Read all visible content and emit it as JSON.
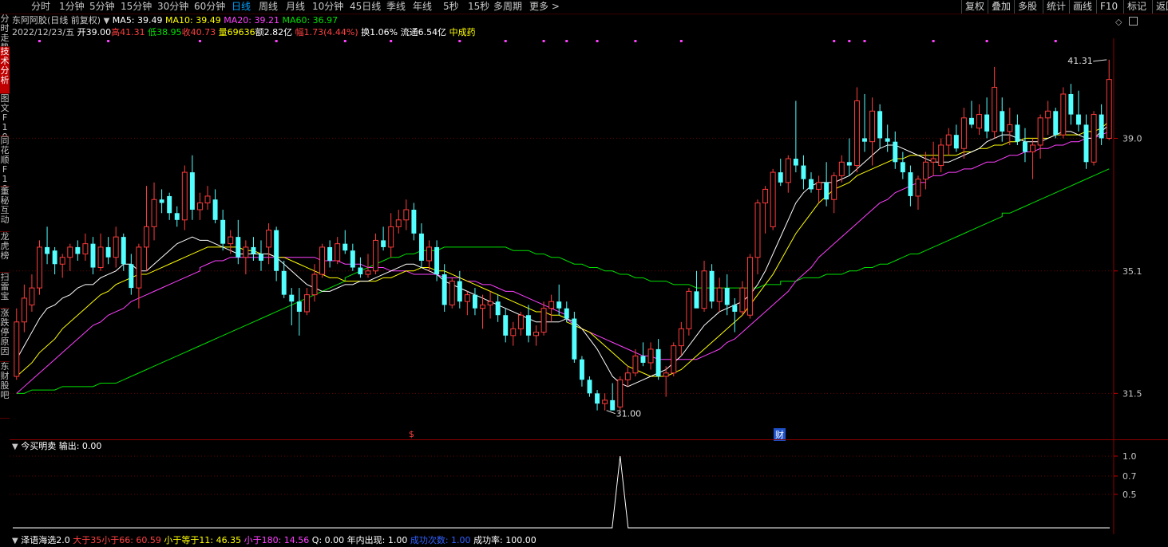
{
  "toolbar": {
    "periods": [
      "分时",
      "1分钟",
      "5分钟",
      "15分钟",
      "30分钟",
      "60分钟",
      "日线",
      "周线",
      "月线",
      "10分钟",
      "45日线",
      "季线",
      "年线",
      "5秒",
      "15秒",
      "多周期",
      "更多 >"
    ],
    "active_period": "日线",
    "right_buttons": [
      "复权",
      "叠加",
      "多股",
      "统计",
      "画线",
      "F10",
      "标记",
      "返回"
    ]
  },
  "sidebar": {
    "tabs": [
      "分时走势",
      "技术分析",
      "图文F10",
      "同花顺F10",
      "董秘互动",
      "龙虎榜",
      "扫雷宝",
      "涨跌停原因",
      "东财股吧"
    ],
    "active": "技术分析"
  },
  "quote": {
    "name": "东阿阿胶(日线 前复权)",
    "ma5": "MA5: 39.49",
    "ma10": "MA10: 39.49",
    "ma20": "MA20: 39.21",
    "ma60": "MA60: 36.97",
    "date": "2022/12/23/五",
    "open": "开39.00",
    "high": "高41.31",
    "low": "低38.95",
    "close": "收40.73",
    "volume": "量69636",
    "amount": "额2.82亿",
    "range": "幅1.73(4.44%)",
    "turnover": "换1.06%",
    "float": "流通6.54亿",
    "sector": "中成药",
    "colors": {
      "up": "#ff3c3c",
      "down": "#54ffff",
      "ma5": "#ffffff",
      "ma10": "#ffff00",
      "ma20": "#ff40ff",
      "ma60": "#00e000"
    }
  },
  "main_chart": {
    "price_ticks": [
      "39.0",
      "35.1",
      "31.5"
    ],
    "high_label": "41.31",
    "low_label": "31.00",
    "event_marks": [
      "$",
      "财"
    ]
  },
  "indicator1": {
    "title": "今买明卖",
    "output": "输出: 0.00",
    "ticks": [
      "1.0",
      "0.7",
      "0.5"
    ]
  },
  "indicator2": {
    "title": "泽语海选2.0",
    "items": [
      "大于35小于66: 60.59",
      "小于等于11: 46.35",
      "小于180: 14.56",
      "Q: 0.00",
      "年内出现: 1.00",
      "成功次数: 1.00",
      "成功率: 100.00"
    ]
  },
  "chart_data": {
    "type": "candlestick",
    "ylim": [
      30.5,
      41.8
    ],
    "candles": [
      [
        32.0,
        34.0,
        31.9,
        33.6
      ],
      [
        33.6,
        34.7,
        33.3,
        34.3
      ],
      [
        34.1,
        35.0,
        33.9,
        34.6
      ],
      [
        34.6,
        36.0,
        34.4,
        35.8
      ],
      [
        35.8,
        36.4,
        35.3,
        35.6
      ],
      [
        35.7,
        35.8,
        35.0,
        35.3
      ],
      [
        35.3,
        35.6,
        34.9,
        35.5
      ],
      [
        35.5,
        35.9,
        35.1,
        35.8
      ],
      [
        35.8,
        36.0,
        35.4,
        35.6
      ],
      [
        35.6,
        36.2,
        35.4,
        35.9
      ],
      [
        35.9,
        36.1,
        35.0,
        35.2
      ],
      [
        35.2,
        36.2,
        35.1,
        35.8
      ],
      [
        35.8,
        36.1,
        35.3,
        35.5
      ],
      [
        35.5,
        36.4,
        35.2,
        36.1
      ],
      [
        36.1,
        36.2,
        35.1,
        35.3
      ],
      [
        35.3,
        35.6,
        34.4,
        34.6
      ],
      [
        34.6,
        35.9,
        34.0,
        35.8
      ],
      [
        35.8,
        37.6,
        35.1,
        36.4
      ],
      [
        36.4,
        37.7,
        36.0,
        37.2
      ],
      [
        37.2,
        37.5,
        36.8,
        37.1
      ],
      [
        37.3,
        37.4,
        36.6,
        36.8
      ],
      [
        36.8,
        37.0,
        36.4,
        36.6
      ],
      [
        36.6,
        38.2,
        36.3,
        38.0
      ],
      [
        38.0,
        38.5,
        36.6,
        36.9
      ],
      [
        36.9,
        37.4,
        36.6,
        37.1
      ],
      [
        37.1,
        37.6,
        36.9,
        37.3
      ],
      [
        37.2,
        37.5,
        36.5,
        36.6
      ],
      [
        36.6,
        36.9,
        35.7,
        35.9
      ],
      [
        35.9,
        36.3,
        35.6,
        36.1
      ],
      [
        36.1,
        36.6,
        35.3,
        35.5
      ],
      [
        35.5,
        36.0,
        35.0,
        35.8
      ],
      [
        35.8,
        36.1,
        35.4,
        35.6
      ],
      [
        35.6,
        36.0,
        35.1,
        35.4
      ],
      [
        35.8,
        36.5,
        35.3,
        36.3
      ],
      [
        36.3,
        36.4,
        34.8,
        35.1
      ],
      [
        35.1,
        35.4,
        34.3,
        34.4
      ],
      [
        34.4,
        34.6,
        33.5,
        34.2
      ],
      [
        34.2,
        34.6,
        33.2,
        33.9
      ],
      [
        33.9,
        34.6,
        33.8,
        34.4
      ],
      [
        34.4,
        35.3,
        34.2,
        35.0
      ],
      [
        35.0,
        35.9,
        34.9,
        35.8
      ],
      [
        35.8,
        36.0,
        35.2,
        35.4
      ],
      [
        35.4,
        36.1,
        35.3,
        35.9
      ],
      [
        35.9,
        36.3,
        35.6,
        35.7
      ],
      [
        35.7,
        35.9,
        35.1,
        35.2
      ],
      [
        35.2,
        35.5,
        34.9,
        35.0
      ],
      [
        35.0,
        35.6,
        34.9,
        35.1
      ],
      [
        35.1,
        36.2,
        35.0,
        36.0
      ],
      [
        36.0,
        36.4,
        35.7,
        35.8
      ],
      [
        35.8,
        36.8,
        35.5,
        36.4
      ],
      [
        36.4,
        36.9,
        36.2,
        36.6
      ],
      [
        36.6,
        37.2,
        36.3,
        36.9
      ],
      [
        36.9,
        37.1,
        36.0,
        36.2
      ],
      [
        36.2,
        36.5,
        35.2,
        35.4
      ],
      [
        35.4,
        36.0,
        35.1,
        35.8
      ],
      [
        35.8,
        36.0,
        34.8,
        35.0
      ],
      [
        35.0,
        35.3,
        33.9,
        34.1
      ],
      [
        34.1,
        34.9,
        34.0,
        34.8
      ],
      [
        34.8,
        35.1,
        34.0,
        34.2
      ],
      [
        34.2,
        34.5,
        33.8,
        34.4
      ],
      [
        34.4,
        34.6,
        33.8,
        34.0
      ],
      [
        34.0,
        34.4,
        33.4,
        34.1
      ],
      [
        34.1,
        34.5,
        33.7,
        34.2
      ],
      [
        34.2,
        34.4,
        33.6,
        33.8
      ],
      [
        33.8,
        34.0,
        33.0,
        33.2
      ],
      [
        33.2,
        33.6,
        32.9,
        33.4
      ],
      [
        33.4,
        33.9,
        33.2,
        33.8
      ],
      [
        33.8,
        34.1,
        33.0,
        33.2
      ],
      [
        33.2,
        33.5,
        32.9,
        33.3
      ],
      [
        33.3,
        34.2,
        33.2,
        34.0
      ],
      [
        34.0,
        34.4,
        33.6,
        34.2
      ],
      [
        34.2,
        34.7,
        33.8,
        34.0
      ],
      [
        34.0,
        34.2,
        33.6,
        33.7
      ],
      [
        33.7,
        33.9,
        32.4,
        32.5
      ],
      [
        32.5,
        32.6,
        31.7,
        31.9
      ],
      [
        31.9,
        32.0,
        31.4,
        31.5
      ],
      [
        31.5,
        31.6,
        31.0,
        31.2
      ],
      [
        31.2,
        31.5,
        31.0,
        31.3
      ],
      [
        31.3,
        31.8,
        31.1,
        31.0
      ],
      [
        31.1,
        32.0,
        31.0,
        31.9
      ],
      [
        31.9,
        32.3,
        31.7,
        32.1
      ],
      [
        32.1,
        32.8,
        32.0,
        32.6
      ],
      [
        32.6,
        33.0,
        32.3,
        32.4
      ],
      [
        32.4,
        33.0,
        32.2,
        32.8
      ],
      [
        32.8,
        33.1,
        31.9,
        32.0
      ],
      [
        32.0,
        32.3,
        31.4,
        32.1
      ],
      [
        32.1,
        33.0,
        32.0,
        32.9
      ],
      [
        32.9,
        33.6,
        32.6,
        33.4
      ],
      [
        33.4,
        34.6,
        33.2,
        34.5
      ],
      [
        34.5,
        35.1,
        34.1,
        34.0
      ],
      [
        34.0,
        35.4,
        33.9,
        35.1
      ],
      [
        35.1,
        35.3,
        34.0,
        34.2
      ],
      [
        34.2,
        34.9,
        33.9,
        34.6
      ],
      [
        34.6,
        35.0,
        33.8,
        34.1
      ],
      [
        34.1,
        34.3,
        33.3,
        33.9
      ],
      [
        33.9,
        34.8,
        33.8,
        34.6
      ],
      [
        33.8,
        35.6,
        33.7,
        35.5
      ],
      [
        35.5,
        37.2,
        35.0,
        37.1
      ],
      [
        37.1,
        37.6,
        36.2,
        37.5
      ],
      [
        36.4,
        38.1,
        36.3,
        38.0
      ],
      [
        38.0,
        38.4,
        37.6,
        37.7
      ],
      [
        37.7,
        38.5,
        37.4,
        38.4
      ],
      [
        38.4,
        40.1,
        38.0,
        38.2
      ],
      [
        38.2,
        38.5,
        37.5,
        37.8
      ],
      [
        37.8,
        38.0,
        37.4,
        37.5
      ],
      [
        37.5,
        37.9,
        37.1,
        37.7
      ],
      [
        37.7,
        38.3,
        37.0,
        37.2
      ],
      [
        37.2,
        38.0,
        36.8,
        37.9
      ],
      [
        37.9,
        38.5,
        37.7,
        38.3
      ],
      [
        38.3,
        39.0,
        37.9,
        38.2
      ],
      [
        38.2,
        40.5,
        38.0,
        40.1
      ],
      [
        39.0,
        40.3,
        38.6,
        38.9
      ],
      [
        38.9,
        40.2,
        38.2,
        39.8
      ],
      [
        39.8,
        40.0,
        38.7,
        39.0
      ],
      [
        39.0,
        39.4,
        38.6,
        38.9
      ],
      [
        38.9,
        39.2,
        38.1,
        38.3
      ],
      [
        38.3,
        38.6,
        37.8,
        38.0
      ],
      [
        38.0,
        38.2,
        37.0,
        37.3
      ],
      [
        37.3,
        37.9,
        36.9,
        37.8
      ],
      [
        37.8,
        38.6,
        37.5,
        38.3
      ],
      [
        38.3,
        38.9,
        37.9,
        38.4
      ],
      [
        38.2,
        39.0,
        38.0,
        38.8
      ],
      [
        38.8,
        39.3,
        38.5,
        39.1
      ],
      [
        39.1,
        39.4,
        38.6,
        38.7
      ],
      [
        38.7,
        39.9,
        38.4,
        39.6
      ],
      [
        39.6,
        40.1,
        39.3,
        39.4
      ],
      [
        39.3,
        40.0,
        39.1,
        39.7
      ],
      [
        39.7,
        40.2,
        39.0,
        39.2
      ],
      [
        39.2,
        41.1,
        39.0,
        40.5
      ],
      [
        39.8,
        40.2,
        38.9,
        39.2
      ],
      [
        39.2,
        39.9,
        38.8,
        39.4
      ],
      [
        39.4,
        39.7,
        38.8,
        38.9
      ],
      [
        38.9,
        39.3,
        38.3,
        38.6
      ],
      [
        38.6,
        39.0,
        37.8,
        38.8
      ],
      [
        38.8,
        39.7,
        38.4,
        39.6
      ],
      [
        39.6,
        40.1,
        39.1,
        39.8
      ],
      [
        39.8,
        39.9,
        39.0,
        39.1
      ],
      [
        39.1,
        40.5,
        39.0,
        40.3
      ],
      [
        40.3,
        40.6,
        39.4,
        39.7
      ],
      [
        39.7,
        40.4,
        39.2,
        39.4
      ],
      [
        39.4,
        39.7,
        38.1,
        38.3
      ],
      [
        38.3,
        39.8,
        38.2,
        39.7
      ],
      [
        39.7,
        40.0,
        38.8,
        39.0
      ],
      [
        39.0,
        41.31,
        38.95,
        40.73
      ]
    ],
    "ma5": [
      32.5,
      32.9,
      33.3,
      33.7,
      34.0,
      34.1,
      34.3,
      34.4,
      34.6,
      34.7,
      34.7,
      34.9,
      35.0,
      35.1,
      35.3,
      35.3,
      35.1,
      35.1,
      35.3,
      35.5,
      35.7,
      35.9,
      36.0,
      36.1,
      36.0,
      36.0,
      35.9,
      35.8,
      35.7,
      35.6,
      35.6,
      35.6,
      35.6,
      35.6,
      35.5,
      35.3,
      35.1,
      34.9,
      34.7,
      34.6,
      34.5,
      34.5,
      34.6,
      34.7,
      34.7,
      34.8,
      34.8,
      34.9,
      35.0,
      35.1,
      35.2,
      35.3,
      35.3,
      35.2,
      35.1,
      35.0,
      34.8,
      34.7,
      34.6,
      34.5,
      34.4,
      34.3,
      34.2,
      34.1,
      34.0,
      33.9,
      33.8,
      33.7,
      33.6,
      33.6,
      33.6,
      33.6,
      33.7,
      33.7,
      33.6,
      33.4,
      33.1,
      32.8,
      32.4,
      32.0,
      31.8,
      31.7,
      31.8,
      31.9,
      32.0,
      32.1,
      32.2,
      32.4,
      32.6,
      32.9,
      33.2,
      33.5,
      33.7,
      33.9,
      34.0,
      34.1,
      34.2,
      34.4,
      34.7,
      35.1,
      35.6,
      36.1,
      36.6,
      37.1,
      37.4,
      37.6,
      37.7,
      37.7,
      37.7,
      37.8,
      37.9,
      38.1,
      38.3,
      38.5,
      38.7,
      38.8,
      38.8,
      38.7,
      38.6,
      38.5,
      38.4,
      38.3,
      38.3,
      38.3,
      38.4,
      38.5,
      38.6,
      38.7,
      38.9,
      39.0,
      39.1,
      39.1,
      39.0,
      38.9,
      38.9,
      38.9,
      39.0,
      39.1,
      39.2,
      39.2,
      39.1,
      39.0,
      39.0,
      39.2,
      39.4
    ],
    "ma10": [
      32.0,
      32.2,
      32.4,
      32.7,
      32.9,
      33.1,
      33.4,
      33.6,
      33.8,
      34.0,
      34.2,
      34.4,
      34.5,
      34.7,
      34.8,
      34.9,
      35.0,
      35.0,
      35.1,
      35.2,
      35.3,
      35.4,
      35.5,
      35.6,
      35.7,
      35.8,
      35.8,
      35.8,
      35.8,
      35.8,
      35.7,
      35.7,
      35.6,
      35.6,
      35.5,
      35.5,
      35.4,
      35.3,
      35.2,
      35.1,
      35.0,
      34.9,
      34.9,
      34.8,
      34.8,
      34.8,
      34.8,
      34.8,
      34.9,
      34.9,
      35.0,
      35.1,
      35.1,
      35.2,
      35.2,
      35.1,
      35.1,
      35.0,
      34.9,
      34.8,
      34.7,
      34.6,
      34.5,
      34.4,
      34.3,
      34.2,
      34.1,
      34.0,
      33.9,
      33.9,
      33.8,
      33.8,
      33.7,
      33.6,
      33.5,
      33.4,
      33.3,
      33.1,
      32.9,
      32.7,
      32.5,
      32.3,
      32.2,
      32.1,
      32.0,
      32.0,
      32.0,
      32.1,
      32.2,
      32.4,
      32.6,
      32.8,
      33.0,
      33.2,
      33.4,
      33.6,
      33.8,
      34.1,
      34.4,
      34.7,
      35.0,
      35.4,
      35.8,
      36.2,
      36.5,
      36.8,
      37.1,
      37.3,
      37.5,
      37.6,
      37.7,
      37.9,
      38.0,
      38.1,
      38.2,
      38.3,
      38.4,
      38.4,
      38.5,
      38.5,
      38.5,
      38.5,
      38.5,
      38.5,
      38.5,
      38.6,
      38.6,
      38.7,
      38.7,
      38.8,
      38.8,
      38.9,
      38.9,
      39.0,
      39.0,
      39.0,
      39.0,
      39.1,
      39.1,
      39.1,
      39.1,
      39.2,
      39.2,
      39.3,
      39.5
    ],
    "ma20": [
      31.5,
      31.7,
      31.9,
      32.1,
      32.3,
      32.5,
      32.7,
      32.9,
      33.1,
      33.3,
      33.5,
      33.6,
      33.8,
      33.9,
      34.0,
      34.2,
      34.3,
      34.4,
      34.5,
      34.6,
      34.7,
      34.8,
      34.9,
      35.0,
      35.1,
      35.2,
      35.3,
      35.4,
      35.4,
      35.5,
      35.5,
      35.5,
      35.5,
      35.5,
      35.5,
      35.5,
      35.5,
      35.5,
      35.5,
      35.5,
      35.5,
      35.4,
      35.4,
      35.4,
      35.3,
      35.3,
      35.3,
      35.2,
      35.2,
      35.2,
      35.1,
      35.1,
      35.1,
      35.0,
      35.0,
      35.0,
      35.0,
      34.9,
      34.9,
      34.9,
      34.8,
      34.8,
      34.7,
      34.7,
      34.6,
      34.5,
      34.5,
      34.4,
      34.3,
      34.2,
      34.1,
      34.0,
      33.9,
      33.8,
      33.7,
      33.5,
      33.4,
      33.3,
      33.2,
      33.1,
      33.0,
      32.9,
      32.8,
      32.7,
      32.6,
      32.6,
      32.5,
      32.5,
      32.5,
      32.5,
      32.5,
      32.5,
      32.6,
      32.7,
      32.8,
      33.0,
      33.1,
      33.3,
      33.5,
      33.7,
      33.9,
      34.1,
      34.3,
      34.5,
      34.8,
      35.0,
      35.2,
      35.5,
      35.7,
      35.9,
      36.1,
      36.3,
      36.5,
      36.7,
      36.9,
      37.1,
      37.2,
      37.4,
      37.5,
      37.6,
      37.7,
      37.7,
      37.8,
      37.9,
      37.9,
      38.0,
      38.0,
      38.1,
      38.1,
      38.2,
      38.3,
      38.3,
      38.4,
      38.5,
      38.5,
      38.6,
      38.6,
      38.7,
      38.7,
      38.8,
      38.8,
      38.9,
      38.9,
      39.0,
      39.0,
      39.1,
      39.2
    ],
    "ma60": [
      31.5,
      31.5,
      31.6,
      31.6,
      31.6,
      31.6,
      31.7,
      31.7,
      31.7,
      31.7,
      31.7,
      31.8,
      31.8,
      31.8,
      31.9,
      31.9,
      32.0,
      32.1,
      32.2,
      32.3,
      32.4,
      32.5,
      32.6,
      32.7,
      32.8,
      32.9,
      33.0,
      33.1,
      33.2,
      33.3,
      33.4,
      33.5,
      33.6,
      33.7,
      33.8,
      33.9,
      34.0,
      34.1,
      34.2,
      34.3,
      34.4,
      34.5,
      34.6,
      34.7,
      34.8,
      34.9,
      35.0,
      35.1,
      35.2,
      35.3,
      35.4,
      35.5,
      35.5,
      35.6,
      35.6,
      35.7,
      35.7,
      35.7,
      35.8,
      35.8,
      35.8,
      35.8,
      35.8,
      35.8,
      35.8,
      35.8,
      35.8,
      35.7,
      35.7,
      35.7,
      35.6,
      35.6,
      35.5,
      35.5,
      35.4,
      35.4,
      35.3,
      35.3,
      35.2,
      35.2,
      35.1,
      35.1,
      35.0,
      35.0,
      34.9,
      34.9,
      34.8,
      34.8,
      34.8,
      34.7,
      34.7,
      34.7,
      34.6,
      34.6,
      34.6,
      34.6,
      34.6,
      34.6,
      34.6,
      34.6,
      34.6,
      34.7,
      34.7,
      34.7,
      34.8,
      34.8,
      34.8,
      34.9,
      34.9,
      34.9,
      35.0,
      35.0,
      35.0,
      35.1,
      35.1,
      35.2,
      35.2,
      35.3,
      35.3,
      35.4,
      35.5,
      35.6,
      35.6,
      35.7,
      35.8,
      35.9,
      36.0,
      36.1,
      36.2,
      36.3,
      36.4,
      36.5,
      36.6,
      36.7,
      36.8,
      36.8,
      36.9,
      37.0,
      37.1,
      37.2,
      37.3,
      37.4,
      37.5,
      37.6,
      37.7,
      37.8,
      37.9,
      38.0,
      38.1
    ]
  },
  "indicator_data": {
    "signal_index": 79,
    "values_zero": 0.0,
    "signal_value": 1.0
  }
}
